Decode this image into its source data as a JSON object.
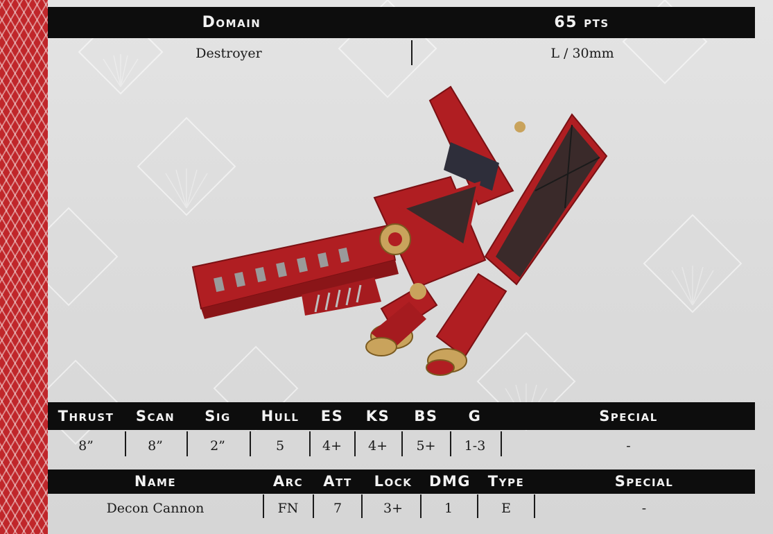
{
  "header": {
    "domain_label": "Domain",
    "points_label": "65 pts",
    "class_value": "Destroyer",
    "base_value": "L / 30mm"
  },
  "stats": {
    "headers": [
      "Thrust",
      "Scan",
      "Sig",
      "Hull",
      "ES",
      "KS",
      "BS",
      "G",
      "Special"
    ],
    "values": [
      "8”",
      "8”",
      "2”",
      "5",
      "4+",
      "4+",
      "5+",
      "1-3",
      "-"
    ]
  },
  "weapons": {
    "headers": [
      "Name",
      "Arc",
      "Att",
      "Lock",
      "DMG",
      "Type",
      "Special"
    ],
    "rows": [
      [
        "Decon Cannon",
        "FN",
        "7",
        "3+",
        "1",
        "E",
        "-"
      ]
    ]
  },
  "colors": {
    "accent_red": "#c0262a",
    "header_black": "#0d0d0d",
    "ship_red": "#b01e22",
    "ship_panel": "#3a2a2a",
    "ship_gold": "#c9a35c"
  },
  "icons": {
    "ship_image": "starship-miniature"
  }
}
